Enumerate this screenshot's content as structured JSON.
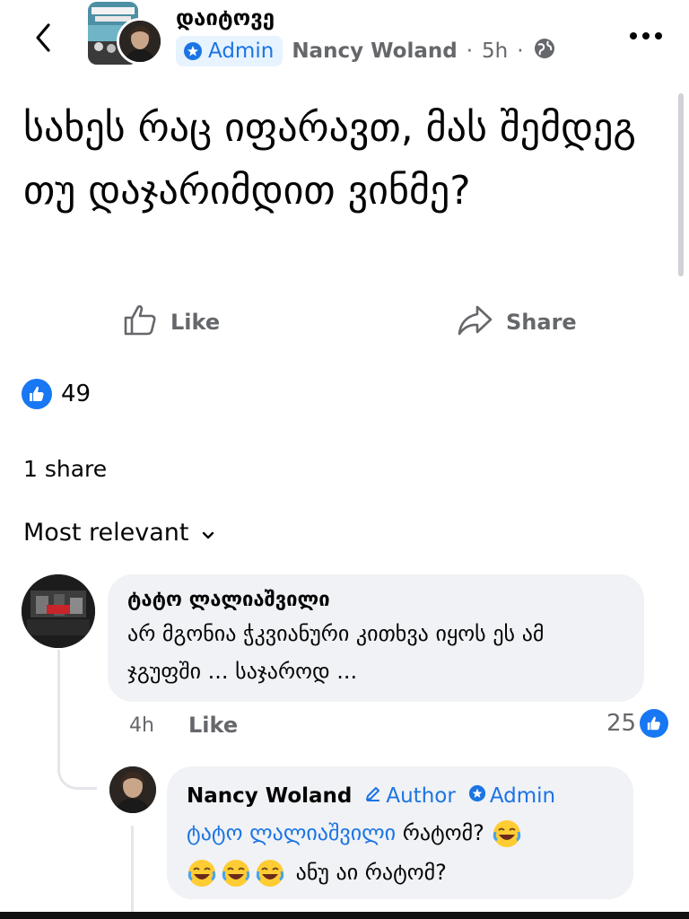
{
  "header": {
    "group_name": "დაიტოვე",
    "role_badge": "Admin",
    "author_name": "Nancy Woland",
    "separator": "·",
    "time": "5h"
  },
  "post": {
    "text": "სახეს რაც იფარავთ, მას შემდეგ თუ დაჯარიმდით ვინმე?"
  },
  "actions": {
    "like_label": "Like",
    "share_label": "Share"
  },
  "reactions": {
    "count": "49"
  },
  "shares": {
    "label": "1 share"
  },
  "sort": {
    "label": "Most relevant"
  },
  "comments": [
    {
      "author": "ტატო ლალიაშვილი",
      "text": "არ მგონია ჭკვიანური კითხვა იყოს ეს ამ ჯგუფში ... საჯაროდ ...",
      "time": "4h",
      "like_label": "Like",
      "reaction_count": "25"
    },
    {
      "author": "Nancy Woland",
      "author_tag": "Author",
      "admin_tag": "Admin",
      "mention": "ტატო ლალიაშვილი",
      "text_part1": " რატომ? ",
      "text_part2": "ანუ აი რატომ?",
      "emoji": "face-with-tears-of-joy"
    }
  ],
  "colors": {
    "accent": "#1877f2",
    "meta_gray": "#65676b",
    "bubble": "#f0f2f5",
    "badge_bg": "#e7f3ff"
  }
}
